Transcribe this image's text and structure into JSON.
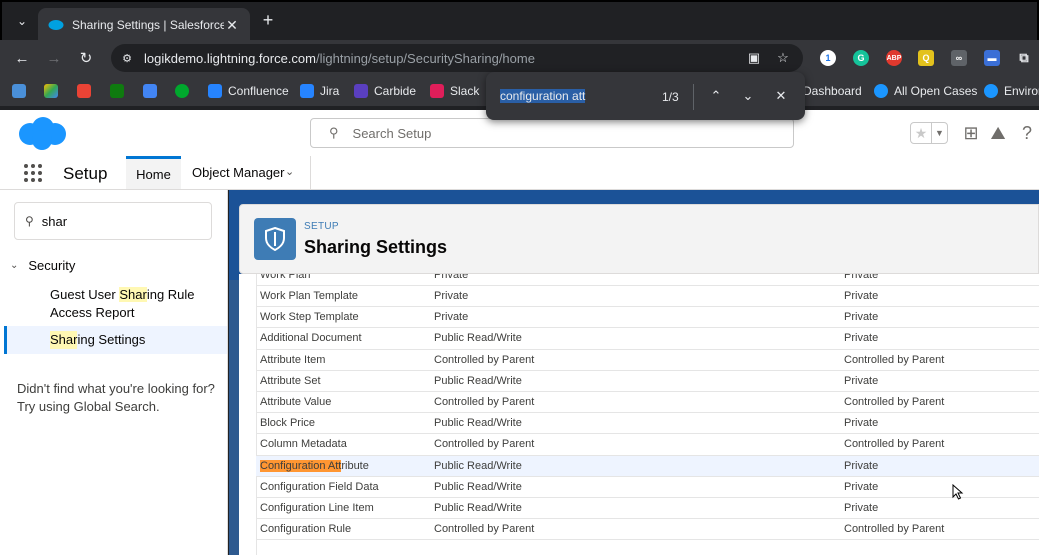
{
  "browser": {
    "tab_title": "Sharing Settings | Salesforce",
    "tab_close": "✕",
    "new_tab": "+",
    "url_host": "logikdemo.lightning.force.com",
    "url_path": "/lightning/setup/SecuritySharing/home",
    "bookmarks": [
      "Confluence",
      "Jira",
      "Carbide",
      "Slack",
      "Dashboard",
      "All Open Cases",
      "Environ"
    ],
    "find": {
      "query": "configuration att",
      "count": "1/3"
    }
  },
  "header": {
    "search_placeholder": "Search Setup"
  },
  "nav": {
    "app_name": "Setup",
    "tabs": [
      "Home",
      "Object Manager"
    ]
  },
  "sidebar": {
    "quick_find_value": "shar",
    "section": "Security",
    "items": [
      {
        "pre": "Guest User ",
        "hl": "Shar",
        "post": "ing Rule Access Report"
      },
      {
        "pre": "",
        "hl": "Shar",
        "post": "ing Settings"
      }
    ],
    "not_found": "Didn't find what you're looking for? Try using Global Search."
  },
  "page": {
    "kicker": "SETUP",
    "title": "Sharing Settings"
  },
  "table": {
    "rows": [
      {
        "name": "Work Plan",
        "default_access": "Private",
        "external_access": "Private"
      },
      {
        "name": "Work Plan Template",
        "default_access": "Private",
        "external_access": "Private"
      },
      {
        "name": "Work Step Template",
        "default_access": "Private",
        "external_access": "Private"
      },
      {
        "name": "Additional Document",
        "default_access": "Public Read/Write",
        "external_access": "Private"
      },
      {
        "name": "Attribute Item",
        "default_access": "Controlled by Parent",
        "external_access": "Controlled by Parent"
      },
      {
        "name": "Attribute Set",
        "default_access": "Public Read/Write",
        "external_access": "Private"
      },
      {
        "name": "Attribute Value",
        "default_access": "Controlled by Parent",
        "external_access": "Controlled by Parent"
      },
      {
        "name": "Block Price",
        "default_access": "Public Read/Write",
        "external_access": "Private"
      },
      {
        "name": "Column Metadata",
        "default_access": "Controlled by Parent",
        "external_access": "Controlled by Parent"
      },
      {
        "name_hl": "Configuration Att",
        "name_rest": "ribute",
        "default_access": "Public Read/Write",
        "external_access": "Private"
      },
      {
        "name": "Configuration Field Data",
        "default_access": "Public Read/Write",
        "external_access": "Private"
      },
      {
        "name": "Configuration Line Item",
        "default_access": "Public Read/Write",
        "external_access": "Private"
      },
      {
        "name": "Configuration Rule",
        "default_access": "Controlled by Parent",
        "external_access": "Controlled by Parent"
      }
    ]
  }
}
